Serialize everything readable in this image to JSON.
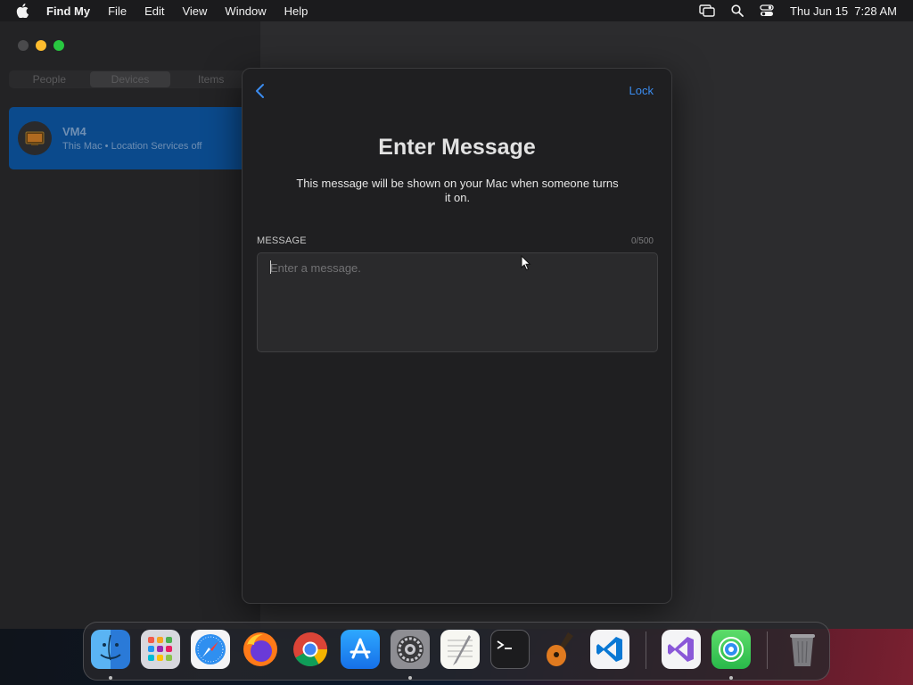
{
  "menubar": {
    "app_name": "Find My",
    "menus": [
      "File",
      "Edit",
      "View",
      "Window",
      "Help"
    ],
    "datetime": "Thu Jun 15  7:28 AM"
  },
  "sidebar": {
    "tabs": [
      "People",
      "Devices",
      "Items"
    ],
    "active_tab": "Devices",
    "devices": [
      {
        "name": "VM4",
        "subtitle": "This Mac • Location Services off"
      }
    ]
  },
  "sheet": {
    "lock_label": "Lock",
    "title": "Enter Message",
    "description": "This message will be shown on your Mac when someone turns it on.",
    "field_label": "MESSAGE",
    "char_count": "0/500",
    "placeholder": "Enter a message.",
    "value": ""
  },
  "dock": {
    "apps": [
      "Finder",
      "Launchpad",
      "Safari",
      "Firefox",
      "Chrome",
      "App Store",
      "System Settings",
      "TextEdit",
      "Terminal",
      "GarageBand",
      "Visual Studio Code",
      "Visual Studio",
      "Find My",
      "Trash"
    ]
  },
  "colors": {
    "accent": "#3b8cf0",
    "selection": "#0b4a8c",
    "sheet_bg": "#1f1f21"
  }
}
